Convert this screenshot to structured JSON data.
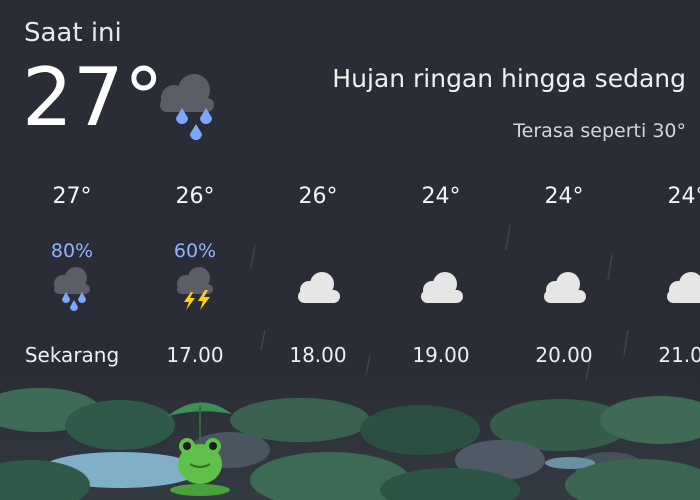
{
  "current": {
    "label": "Saat ini",
    "temperature": "27°",
    "condition": "Hujan ringan hingga sedang",
    "feels_like": "Terasa seperti 30°",
    "icon": "cloud-heavy-rain-icon"
  },
  "hourly": [
    {
      "temp": "27°",
      "precip": "80%",
      "icon": "cloud-rain-icon",
      "time": "Sekarang"
    },
    {
      "temp": "26°",
      "precip": "60%",
      "icon": "cloud-thunderstorm-icon",
      "time": "17.00"
    },
    {
      "temp": "26°",
      "precip": "",
      "icon": "cloud-icon",
      "time": "18.00"
    },
    {
      "temp": "24°",
      "precip": "",
      "icon": "cloud-icon",
      "time": "19.00"
    },
    {
      "temp": "24°",
      "precip": "",
      "icon": "cloud-icon",
      "time": "20.00"
    },
    {
      "temp": "24°",
      "precip": "",
      "icon": "cloud-icon",
      "time": "21.00"
    }
  ],
  "colors": {
    "background": "#2a2d35",
    "precip_text": "#8fb4ff",
    "rain_drop": "#7da7ff",
    "cloud_dark": "#5b5e66",
    "cloud_light": "#e6e6e6",
    "lightning": "#ffd21a"
  }
}
